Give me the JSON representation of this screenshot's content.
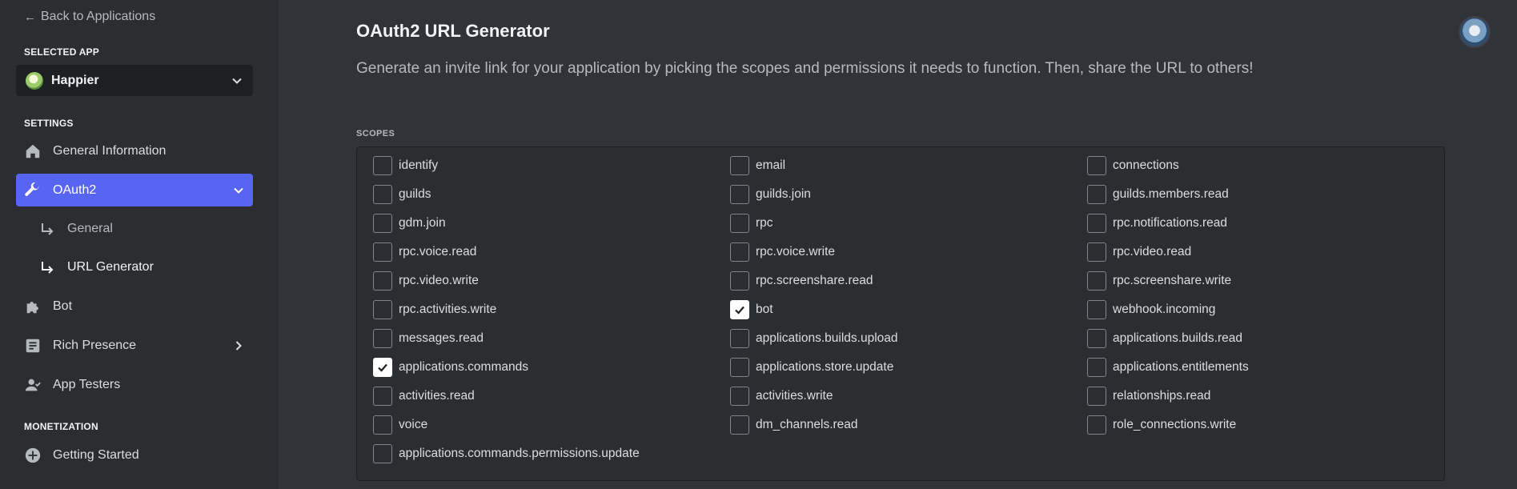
{
  "sidebar": {
    "back_label": "Back to Applications",
    "selected_app_label": "SELECTED APP",
    "app_name": "Happier",
    "settings_label": "SETTINGS",
    "monetization_label": "MONETIZATION",
    "items": [
      {
        "label": "General Information",
        "icon": "home-icon"
      },
      {
        "label": "OAuth2",
        "icon": "wrench-icon",
        "active": true
      },
      {
        "label": "Bot",
        "icon": "puzzle-icon"
      },
      {
        "label": "Rich Presence",
        "icon": "document-icon"
      },
      {
        "label": "App Testers",
        "icon": "user-icon"
      },
      {
        "label": "Getting Started",
        "icon": "plus-circle-icon"
      }
    ],
    "sub_items": [
      {
        "label": "General"
      },
      {
        "label": "URL Generator",
        "current": true
      }
    ]
  },
  "main": {
    "title": "OAuth2 URL Generator",
    "description": "Generate an invite link for your application by picking the scopes and permissions it needs to function. Then, share the URL to others!",
    "scopes_label": "SCOPES",
    "scopes": [
      [
        {
          "name": "identify",
          "checked": false
        },
        {
          "name": "guilds",
          "checked": false
        },
        {
          "name": "gdm.join",
          "checked": false
        },
        {
          "name": "rpc.voice.read",
          "checked": false
        },
        {
          "name": "rpc.video.write",
          "checked": false
        },
        {
          "name": "rpc.activities.write",
          "checked": false
        },
        {
          "name": "messages.read",
          "checked": false
        },
        {
          "name": "applications.commands",
          "checked": true
        },
        {
          "name": "activities.read",
          "checked": false
        },
        {
          "name": "voice",
          "checked": false
        },
        {
          "name": "applications.commands.permissions.update",
          "checked": false
        }
      ],
      [
        {
          "name": "email",
          "checked": false
        },
        {
          "name": "guilds.join",
          "checked": false
        },
        {
          "name": "rpc",
          "checked": false
        },
        {
          "name": "rpc.voice.write",
          "checked": false
        },
        {
          "name": "rpc.screenshare.read",
          "checked": false
        },
        {
          "name": "bot",
          "checked": true
        },
        {
          "name": "applications.builds.upload",
          "checked": false
        },
        {
          "name": "applications.store.update",
          "checked": false
        },
        {
          "name": "activities.write",
          "checked": false
        },
        {
          "name": "dm_channels.read",
          "checked": false
        }
      ],
      [
        {
          "name": "connections",
          "checked": false
        },
        {
          "name": "guilds.members.read",
          "checked": false
        },
        {
          "name": "rpc.notifications.read",
          "checked": false
        },
        {
          "name": "rpc.video.read",
          "checked": false
        },
        {
          "name": "rpc.screenshare.write",
          "checked": false
        },
        {
          "name": "webhook.incoming",
          "checked": false
        },
        {
          "name": "applications.builds.read",
          "checked": false
        },
        {
          "name": "applications.entitlements",
          "checked": false
        },
        {
          "name": "relationships.read",
          "checked": false
        },
        {
          "name": "role_connections.write",
          "checked": false
        }
      ]
    ]
  },
  "colors": {
    "accent": "#5865f2",
    "sidebar_bg": "#2b2d31",
    "main_bg": "#313338"
  }
}
